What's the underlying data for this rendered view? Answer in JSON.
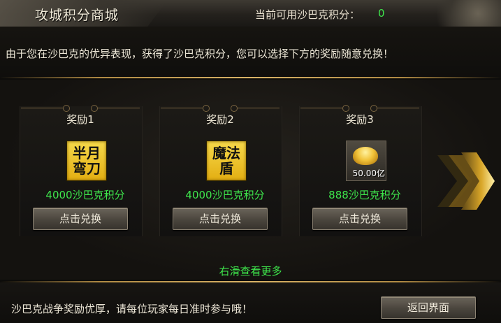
{
  "header": {
    "title": "攻城积分商城",
    "score_label": "当前可用沙巴克积分：",
    "score_value": "0"
  },
  "intro": "由于您在沙巴克的优异表现，获得了沙巴克积分，您可以选择下方的奖励随意兑换！",
  "rewards": [
    {
      "title": "奖励1",
      "icon": "半月弯刀",
      "cost": "4000沙巴克积分",
      "button": "点击兑换"
    },
    {
      "title": "奖励2",
      "icon": "魔法盾",
      "cost": "4000沙巴克积分",
      "button": "点击兑换"
    },
    {
      "title": "奖励3",
      "icon": "gold-ingot-icon",
      "amount": "50.00亿",
      "cost": "888沙巴克积分",
      "button": "点击兑换"
    }
  ],
  "more_hint": "右滑查看更多",
  "footer": {
    "message": "沙巴克战争奖励优厚，请每位玩家每日准时参与哦！",
    "back_button": "返回界面"
  },
  "colors": {
    "accent_green": "#3ee64c",
    "gold_line": "#d9b366",
    "icon_gold": "#f6d94b"
  }
}
